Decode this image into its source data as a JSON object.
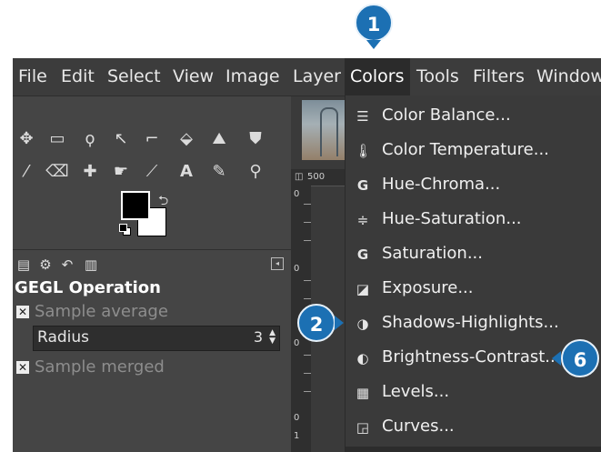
{
  "menubar": {
    "items": [
      "File",
      "Edit",
      "Select",
      "View",
      "Image",
      "Layer",
      "Colors",
      "Tools",
      "Filters",
      "Windows"
    ],
    "active": "Colors"
  },
  "toolbox": {
    "tools": [
      "move-icon",
      "rect-select-icon",
      "free-select-icon",
      "fuzzy-select-icon",
      "crop-icon",
      "transform-icon",
      "warp-icon",
      "bucket-fill-icon",
      "paintbrush-icon",
      "eraser-icon",
      "heal-icon",
      "smudge-icon",
      "paths-icon",
      "text-icon",
      "color-picker-icon",
      "zoom-icon"
    ],
    "tabs": [
      "tool-options-icon",
      "device-status-icon",
      "undo-history-icon",
      "images-icon"
    ]
  },
  "gegl": {
    "title": "GEGL Operation",
    "sample_average": "Sample average",
    "radius_label": "Radius",
    "radius_value": "3",
    "sample_merged": "Sample merged"
  },
  "ruler": {
    "top_label": "500",
    "left_marks": [
      "0",
      "0",
      "0",
      "0",
      "1",
      "0",
      "1",
      "0"
    ]
  },
  "dropdown": {
    "items": [
      {
        "label": "Color Balance...",
        "icon": "color-balance-icon"
      },
      {
        "label": "Color Temperature...",
        "icon": "color-temperature-icon"
      },
      {
        "label": "Hue-Chroma...",
        "icon": "hue-chroma-icon"
      },
      {
        "label": "Hue-Saturation...",
        "icon": "hue-saturation-icon"
      },
      {
        "label": "Saturation...",
        "icon": "saturation-icon"
      },
      {
        "label": "Exposure...",
        "icon": "exposure-icon"
      },
      {
        "label": "Shadows-Highlights...",
        "icon": "shadows-highlights-icon"
      },
      {
        "label": "Brightness-Contrast...",
        "icon": "brightness-contrast-icon"
      },
      {
        "label": "Levels...",
        "icon": "levels-icon"
      },
      {
        "label": "Curves...",
        "icon": "curves-icon"
      }
    ]
  },
  "callouts": [
    "1",
    "2",
    "6"
  ],
  "colors": {
    "accent": "#1c70b3",
    "menu_bg": "#3c3c3c",
    "active_bg": "#2b2b2b"
  }
}
